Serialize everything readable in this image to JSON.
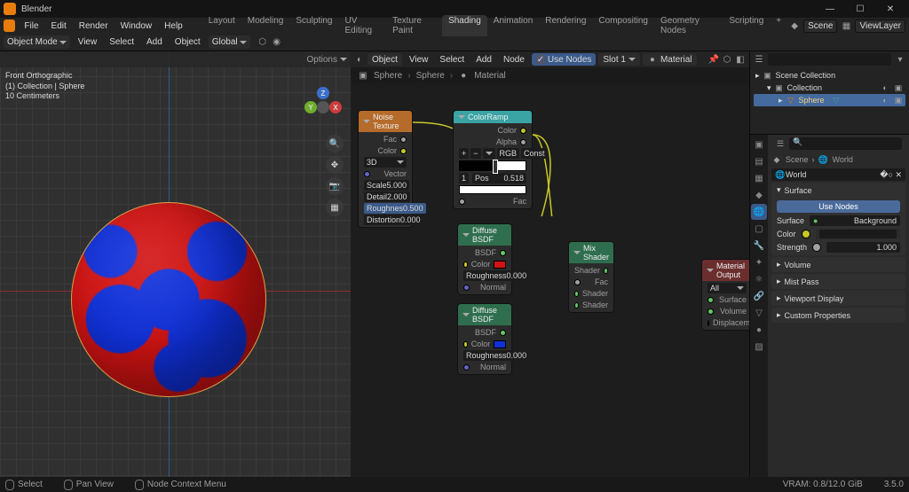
{
  "title": "Blender",
  "menus": [
    "File",
    "Edit",
    "Render",
    "Window",
    "Help"
  ],
  "workspaces": [
    "Layout",
    "Modeling",
    "Sculpting",
    "UV Editing",
    "Texture Paint",
    "Shading",
    "Animation",
    "Rendering",
    "Compositing",
    "Geometry Nodes",
    "Scripting"
  ],
  "active_workspace": "Shading",
  "scene": "Scene",
  "viewlayer": "ViewLayer",
  "object_mode": "Object Mode",
  "hdr2": {
    "view": "View",
    "select": "Select",
    "add": "Add",
    "object": "Object",
    "global": "Global"
  },
  "viewport": {
    "options": "Options",
    "info1": "Front Orthographic",
    "info2": "(1) Collection | Sphere",
    "info3": "10 Centimeters"
  },
  "node_editor": {
    "menus": [
      "View",
      "Select",
      "Add",
      "Node"
    ],
    "object_label": "Object",
    "use_nodes": "Use Nodes",
    "slot": "Slot 1",
    "material": "Material",
    "breadcrumb": [
      "Sphere",
      "Sphere",
      "Material"
    ]
  },
  "nodes": {
    "noise": {
      "title": "Noise Texture",
      "out_fac": "Fac",
      "out_color": "Color",
      "dim": "3D",
      "vector": "Vector",
      "scale_l": "Scale",
      "scale_v": "5.000",
      "detail_l": "Detail",
      "detail_v": "2.000",
      "rough_l": "Roughnes",
      "rough_v": "0.500",
      "dist_l": "Distortion",
      "dist_v": "0.000"
    },
    "ramp": {
      "title": "ColorRamp",
      "out_color": "Color",
      "out_alpha": "Alpha",
      "mode1": "RGB",
      "mode2": "Const",
      "pos_l": "Pos",
      "pos_v": "0.518",
      "in_fac": "Fac"
    },
    "diff1": {
      "title": "Diffuse BSDF",
      "out": "BSDF",
      "color": "Color",
      "rough_l": "Roughness",
      "rough_v": "0.000",
      "normal": "Normal"
    },
    "diff2": {
      "title": "Diffuse BSDF",
      "out": "BSDF",
      "color": "Color",
      "rough_l": "Roughness",
      "rough_v": "0.000",
      "normal": "Normal"
    },
    "mix": {
      "title": "Mix Shader",
      "out": "Shader",
      "fac": "Fac",
      "sh1": "Shader",
      "sh2": "Shader"
    },
    "output": {
      "title": "Material Output",
      "target": "All",
      "surface": "Surface",
      "volume": "Volume",
      "disp": "Displacement"
    }
  },
  "outliner": {
    "scene_collection": "Scene Collection",
    "collection": "Collection",
    "sphere": "Sphere"
  },
  "properties": {
    "crumb_scene": "Scene",
    "crumb_world": "World",
    "world": "World",
    "surface_panel": "Surface",
    "use_nodes": "Use Nodes",
    "surface_l": "Surface",
    "surface_v": "Background",
    "color_l": "Color",
    "strength_l": "Strength",
    "strength_v": "1.000",
    "panels": [
      "Volume",
      "Mist Pass",
      "Viewport Display",
      "Custom Properties"
    ]
  },
  "footer": {
    "select": "Select",
    "pan": "Pan View",
    "context": "Node Context Menu",
    "vram": "VRAM: 0.8/12.0 GiB",
    "ver": "3.5.0"
  }
}
